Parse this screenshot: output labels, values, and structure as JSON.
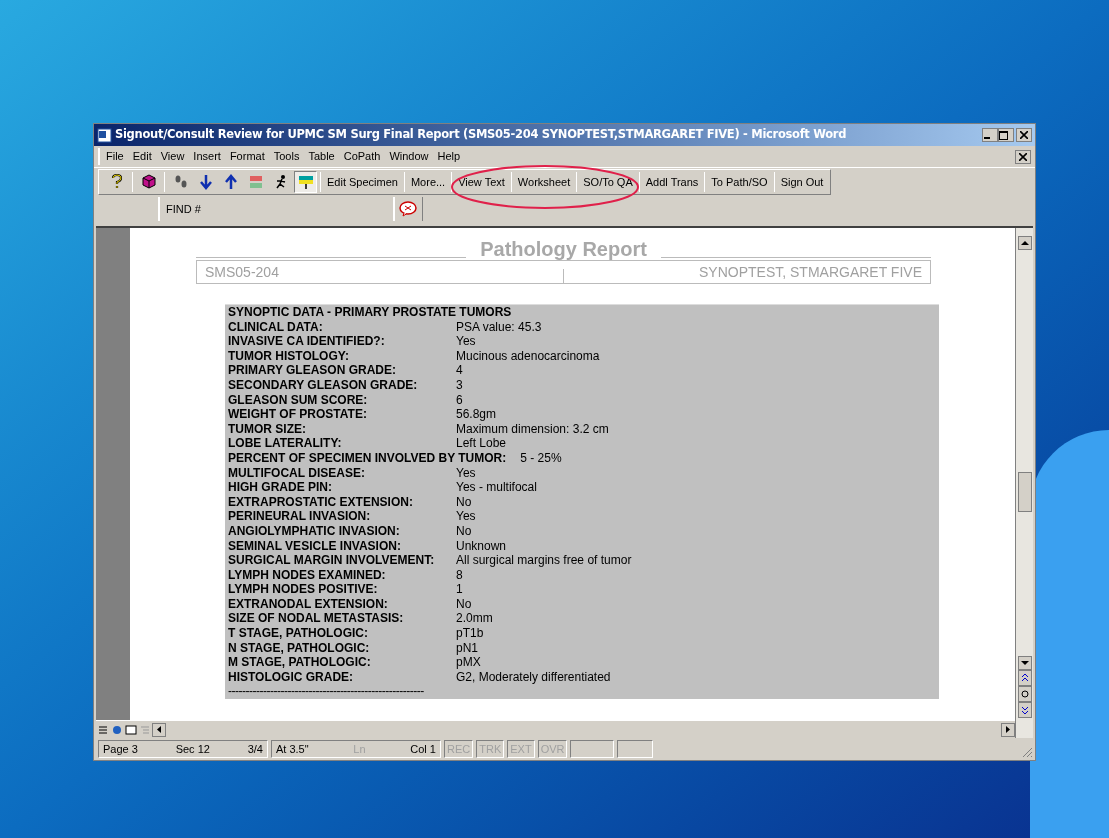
{
  "window": {
    "title": "Signout/Consult Review for UPMC SM Surg Final Report (SMS05-204 SYNOPTEST,STMARGARET FIVE) - Microsoft Word"
  },
  "menu": [
    "File",
    "Edit",
    "View",
    "Insert",
    "Format",
    "Tools",
    "Table",
    "CoPath",
    "Window",
    "Help"
  ],
  "toolbar": {
    "icons": [
      {
        "kind": "help",
        "pressed": false
      },
      {
        "kind": "cube",
        "pressed": false
      },
      {
        "kind": "footprints",
        "pressed": false
      },
      {
        "kind": "down",
        "pressed": false
      },
      {
        "kind": "up",
        "pressed": false
      },
      {
        "kind": "list",
        "pressed": false
      },
      {
        "kind": "runner",
        "pressed": false
      },
      {
        "kind": "highlighter",
        "pressed": true
      }
    ],
    "buttons": [
      "Edit Specimen",
      "More...",
      "View Text",
      "Worksheet",
      "SO/To QA",
      "Addl Trans",
      "To Path/SO",
      "Sign Out"
    ]
  },
  "toolbar2": {
    "find": "FIND #"
  },
  "report": {
    "title": "Pathology Report",
    "accession": "SMS05-204",
    "patient": "SYNOPTEST, STMARGARET FIVE",
    "heading": "SYNOPTIC DATA - PRIMARY PROSTATE TUMORS",
    "rows": [
      {
        "label": "CLINICAL DATA:",
        "value": "PSA value: 45.3"
      },
      {
        "label": "INVASIVE CA IDENTIFIED?:",
        "value": "Yes"
      },
      {
        "label": "TUMOR HISTOLOGY:",
        "value": "Mucinous adenocarcinoma"
      },
      {
        "label": "PRIMARY GLEASON GRADE:",
        "value": "4"
      },
      {
        "label": "SECONDARY GLEASON GRADE:",
        "value": "3"
      },
      {
        "label": "GLEASON SUM SCORE:",
        "value": "6"
      },
      {
        "label": "WEIGHT OF PROSTATE:",
        "value": "56.8gm"
      },
      {
        "label": "TUMOR SIZE:",
        "value": "Maximum dimension:  3.2 cm"
      },
      {
        "label": "LOBE LATERALITY:",
        "value": "Left Lobe"
      },
      {
        "label": "PERCENT OF SPECIMEN INVOLVED BY TUMOR:",
        "value": "5 - 25%"
      },
      {
        "label": "MULTIFOCAL DISEASE:",
        "value": "Yes"
      },
      {
        "label": "HIGH GRADE PIN:",
        "value": "Yes - multifocal"
      },
      {
        "label": "EXTRAPROSTATIC EXTENSION:",
        "value": "No"
      },
      {
        "label": "PERINEURAL INVASION:",
        "value": "Yes"
      },
      {
        "label": "ANGIOLYMPHATIC INVASION:",
        "value": "No"
      },
      {
        "label": "SEMINAL VESICLE INVASION:",
        "value": "Unknown"
      },
      {
        "label": "SURGICAL MARGIN INVOLVEMENT:",
        "value": "All surgical margins free of tumor"
      },
      {
        "label": "LYMPH NODES EXAMINED:",
        "value": "8"
      },
      {
        "label": "LYMPH NODES POSITIVE:",
        "value": "1"
      },
      {
        "label": "EXTRANODAL EXTENSION:",
        "value": "No"
      },
      {
        "label": "SIZE OF NODAL METASTASIS:",
        "value": "2.0mm"
      },
      {
        "label": "T STAGE, PATHOLOGIC:",
        "value": "pT1b"
      },
      {
        "label": "N STAGE, PATHOLOGIC:",
        "value": "pN1"
      },
      {
        "label": "M STAGE, PATHOLOGIC:",
        "value": "pMX"
      },
      {
        "label": "HISTOLOGIC GRADE:",
        "value": "G2, Moderately differentiated"
      }
    ],
    "rule": "--------------------------------------------------------"
  },
  "status_bar": [
    {
      "kind": "panel",
      "items": [
        {
          "text": "Page 3",
          "disabled": false
        },
        {
          "text": "Sec 12",
          "disabled": false
        },
        {
          "text": "3/4",
          "disabled": false
        }
      ]
    },
    {
      "kind": "panel",
      "items": [
        {
          "text": "At 3.5\"",
          "disabled": false
        },
        {
          "text": "Ln",
          "disabled": true
        },
        {
          "text": "Col 1",
          "disabled": false
        }
      ]
    },
    {
      "kind": "indicators",
      "items": [
        {
          "text": "REC",
          "disabled": true
        },
        {
          "text": "TRK",
          "disabled": true
        },
        {
          "text": "EXT",
          "disabled": true
        },
        {
          "text": "OVR",
          "disabled": true
        }
      ]
    }
  ]
}
